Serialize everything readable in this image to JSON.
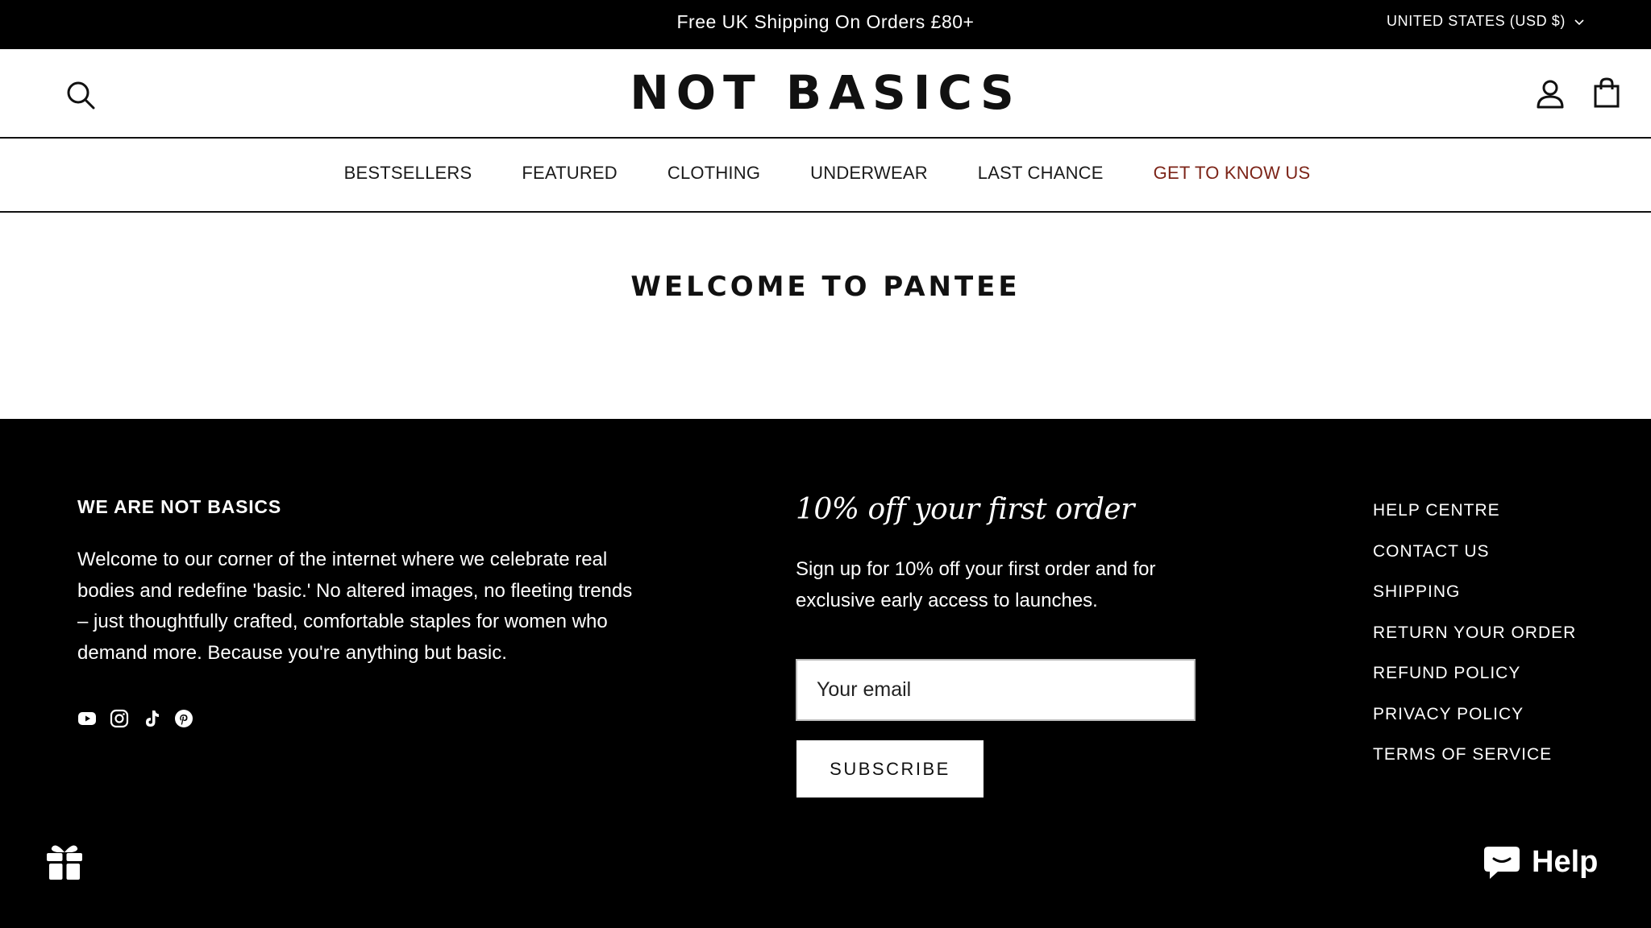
{
  "announcement": {
    "text": "Free UK Shipping On Orders £80+",
    "currency": "UNITED STATES (USD $)"
  },
  "header": {
    "logo": "NOT BASICS",
    "icons": {
      "search": "search-icon",
      "account": "account-icon",
      "cart": "shopping-bag-icon"
    }
  },
  "nav": {
    "items": [
      "BESTSELLERS",
      "FEATURED",
      "CLOTHING",
      "UNDERWEAR",
      "LAST CHANCE",
      "GET TO KNOW US"
    ],
    "highlight_color": "#7c2418"
  },
  "main": {
    "title": "WELCOME TO PANTEE"
  },
  "footer": {
    "about_heading": "WE ARE NOT BASICS",
    "about_text": "Welcome to our corner of the internet where we celebrate real bodies and redefine 'basic.' No altered images, no fleeting trends – just thoughtfully crafted, comfortable staples for women who demand more. Because you're anything but basic.",
    "socials": [
      "youtube-icon",
      "instagram-icon",
      "tiktok-icon",
      "pinterest-icon"
    ],
    "promo_heading": "10% off your first order",
    "promo_text": "Sign up for 10% off your first order and for exclusive early access to launches.",
    "email_placeholder": "Your email",
    "subscribe_label": "SUBSCRIBE",
    "links": [
      "HELP CENTRE",
      "CONTACT US",
      "SHIPPING",
      "RETURN YOUR ORDER",
      "REFUND POLICY",
      "PRIVACY POLICY",
      "TERMS OF SERVICE"
    ],
    "background_color": "#000000"
  },
  "widgets": {
    "help_label": "Help",
    "gift_icon": "gift-icon",
    "chat_icon": "chat-icon"
  }
}
